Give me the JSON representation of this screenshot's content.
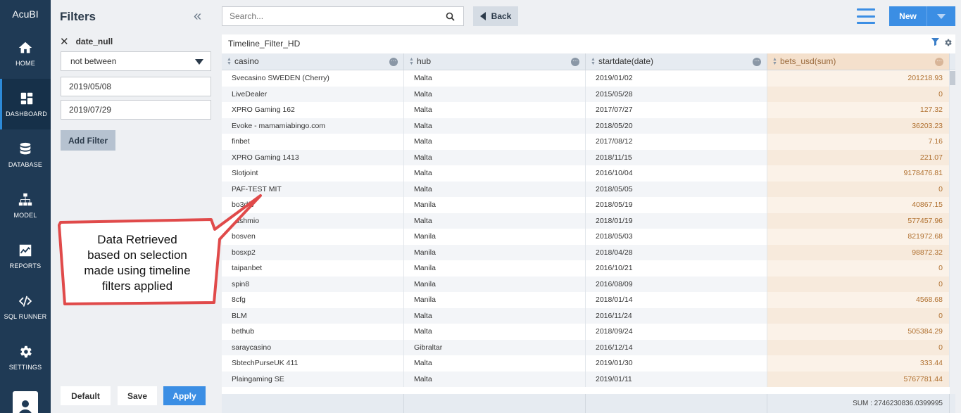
{
  "app": {
    "title": "AcuBI"
  },
  "nav": {
    "items": [
      {
        "label": "HOME",
        "icon": "home-icon"
      },
      {
        "label": "DASHBOARD",
        "icon": "dashboard-icon"
      },
      {
        "label": "DATABASE",
        "icon": "database-icon"
      },
      {
        "label": "MODEL",
        "icon": "model-icon"
      },
      {
        "label": "REPORTS",
        "icon": "reports-icon"
      },
      {
        "label": "SQL RUNNER",
        "icon": "code-icon"
      },
      {
        "label": "SETTINGS",
        "icon": "gear-icon"
      }
    ],
    "active": "DASHBOARD"
  },
  "filters": {
    "title": "Filters",
    "field_name": "date_null",
    "operator": "not between",
    "date_from": "2019/05/08",
    "date_to": "2019/07/29",
    "add_filter_label": "Add Filter",
    "default_label": "Default",
    "save_label": "Save",
    "apply_label": "Apply"
  },
  "topbar": {
    "search_placeholder": "Search...",
    "back_label": "Back",
    "new_label": "New"
  },
  "report": {
    "title": "Timeline_Filter_HD",
    "columns": [
      "casino",
      "hub",
      "startdate(date)",
      "bets_usd(sum)"
    ],
    "highlight_color": "#f4e0cc",
    "rows": [
      [
        "Svecasino SWEDEN (Cherry)",
        "Malta",
        "2019/01/02",
        "201218.93"
      ],
      [
        "LiveDealer",
        "Malta",
        "2015/05/28",
        "0"
      ],
      [
        "XPRO Gaming 162",
        "Malta",
        "2017/07/27",
        "127.32"
      ],
      [
        "Evoke - mamamiabingo.com",
        "Malta",
        "2018/05/20",
        "36203.23"
      ],
      [
        "finbet",
        "Malta",
        "2017/08/12",
        "7.16"
      ],
      [
        "XPRO Gaming 1413",
        "Malta",
        "2018/11/15",
        "221.07"
      ],
      [
        "Slotjoint",
        "Malta",
        "2016/10/04",
        "9178476.81"
      ],
      [
        "PAF-TEST MIT",
        "Malta",
        "2018/05/05",
        "0"
      ],
      [
        "bo3dfc",
        "Manila",
        "2018/05/19",
        "40867.15"
      ],
      [
        "cashmio",
        "Malta",
        "2018/01/19",
        "577457.96"
      ],
      [
        "bosven",
        "Manila",
        "2018/05/03",
        "821972.68"
      ],
      [
        "bosxp2",
        "Manila",
        "2018/04/28",
        "98872.32"
      ],
      [
        "taipanbet",
        "Manila",
        "2016/10/21",
        "0"
      ],
      [
        "spin8",
        "Manila",
        "2016/08/09",
        "0"
      ],
      [
        "8cfg",
        "Manila",
        "2018/01/14",
        "4568.68"
      ],
      [
        "BLM",
        "Malta",
        "2016/11/24",
        "0"
      ],
      [
        "bethub",
        "Malta",
        "2018/09/24",
        "505384.29"
      ],
      [
        "saraycasino",
        "Gibraltar",
        "2016/12/14",
        "0"
      ],
      [
        "SbtechPurseUK 411",
        "Malta",
        "2019/01/30",
        "333.44"
      ],
      [
        "Plaingaming SE",
        "Malta",
        "2019/01/11",
        "5767781.44"
      ]
    ],
    "sum_text": "SUM : 2746230836.0399995"
  },
  "annotation": {
    "text": "Data Retrieved based on selection made using timeline filters applied",
    "lines": [
      "Data Retrieved",
      "based on selection",
      "made using timeline",
      "filters applied"
    ],
    "color": "#e04a4a"
  }
}
